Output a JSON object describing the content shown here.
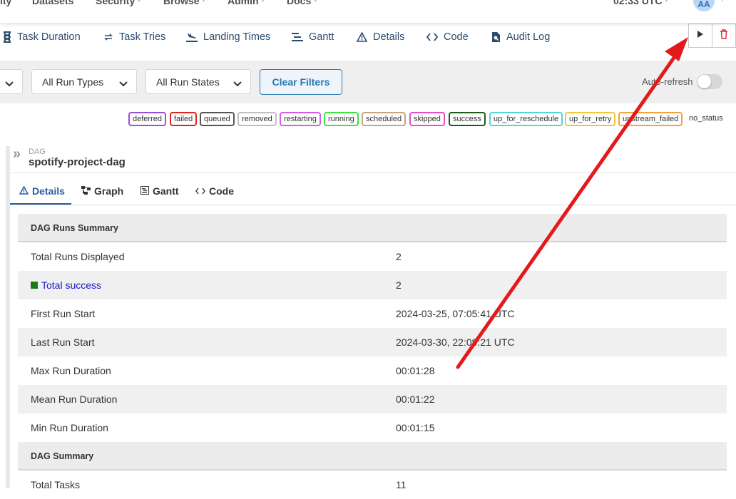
{
  "navbar": {
    "items": [
      {
        "label": "ity",
        "caret": false
      },
      {
        "label": "Datasets",
        "caret": false
      },
      {
        "label": "Security",
        "caret": true
      },
      {
        "label": "Browse",
        "caret": true
      },
      {
        "label": "Admin",
        "caret": true
      },
      {
        "label": "Docs",
        "caret": true
      }
    ],
    "clock": "02:33 UTC",
    "avatar": "AA"
  },
  "view_tabs": [
    {
      "label": "Task Duration",
      "icon": "hourglass-icon"
    },
    {
      "label": "Task Tries",
      "icon": "retry-icon"
    },
    {
      "label": "Landing Times",
      "icon": "landing-plane-icon"
    },
    {
      "label": "Gantt",
      "icon": "gantt-icon"
    },
    {
      "label": "Details",
      "icon": "warning-triangle-icon"
    },
    {
      "label": "Code",
      "icon": "code-icon"
    },
    {
      "label": "Audit Log",
      "icon": "file-search-icon"
    }
  ],
  "actions": {
    "trigger": "play-icon",
    "delete": "trash-icon"
  },
  "filters": {
    "run_types": "All Run Types",
    "run_states": "All Run States",
    "clear_label": "Clear Filters",
    "auto_refresh_label": "Auto-refresh",
    "auto_refresh_on": false
  },
  "legend": {
    "states": [
      {
        "label": "deferred",
        "color": "#9b4fd6"
      },
      {
        "label": "failed",
        "color": "#e0251b"
      },
      {
        "label": "queued",
        "color": "#555555"
      },
      {
        "label": "removed",
        "color": "#bfbfbf"
      },
      {
        "label": "restarting",
        "color": "#d35ee6"
      },
      {
        "label": "running",
        "color": "#3fe23f"
      },
      {
        "label": "scheduled",
        "color": "#c5a77d"
      },
      {
        "label": "skipped",
        "color": "#e64ecf"
      },
      {
        "label": "success",
        "color": "#1a5e1a"
      },
      {
        "label": "up_for_reschedule",
        "color": "#52d6d0"
      },
      {
        "label": "up_for_retry",
        "color": "#f2c637"
      },
      {
        "label": "upstream_failed",
        "color": "#f0a43a"
      }
    ],
    "no_status": "no_status"
  },
  "details": {
    "dag_label": "DAG",
    "dag_id": "spotify-project-dag",
    "tabs": [
      {
        "label": "Details",
        "icon": "warning-triangle-icon"
      },
      {
        "label": "Graph",
        "icon": "graph-icon"
      },
      {
        "label": "Gantt",
        "icon": "gantt-icon"
      },
      {
        "label": "Code",
        "icon": "code-icon"
      }
    ],
    "runs_summary_title": "DAG Runs Summary",
    "runs_summary": [
      {
        "key": "Total Runs Displayed",
        "value": "2"
      },
      {
        "key": "Total success",
        "value": "2"
      },
      {
        "key": "First Run Start",
        "value": "2024-03-25, 07:05:41 UTC"
      },
      {
        "key": "Last Run Start",
        "value": "2024-03-30, 22:09:21 UTC"
      },
      {
        "key": "Max Run Duration",
        "value": "00:01:28"
      },
      {
        "key": "Mean Run Duration",
        "value": "00:01:22"
      },
      {
        "key": "Min Run Duration",
        "value": "00:01:15"
      }
    ],
    "dag_summary_title": "DAG Summary",
    "dag_summary": [
      {
        "key": "Total Tasks",
        "value": "11"
      }
    ]
  },
  "colors": {
    "accent": "#2a5ea0",
    "annotation_arrow": "#e3191b",
    "success": "#1a7a1a"
  }
}
